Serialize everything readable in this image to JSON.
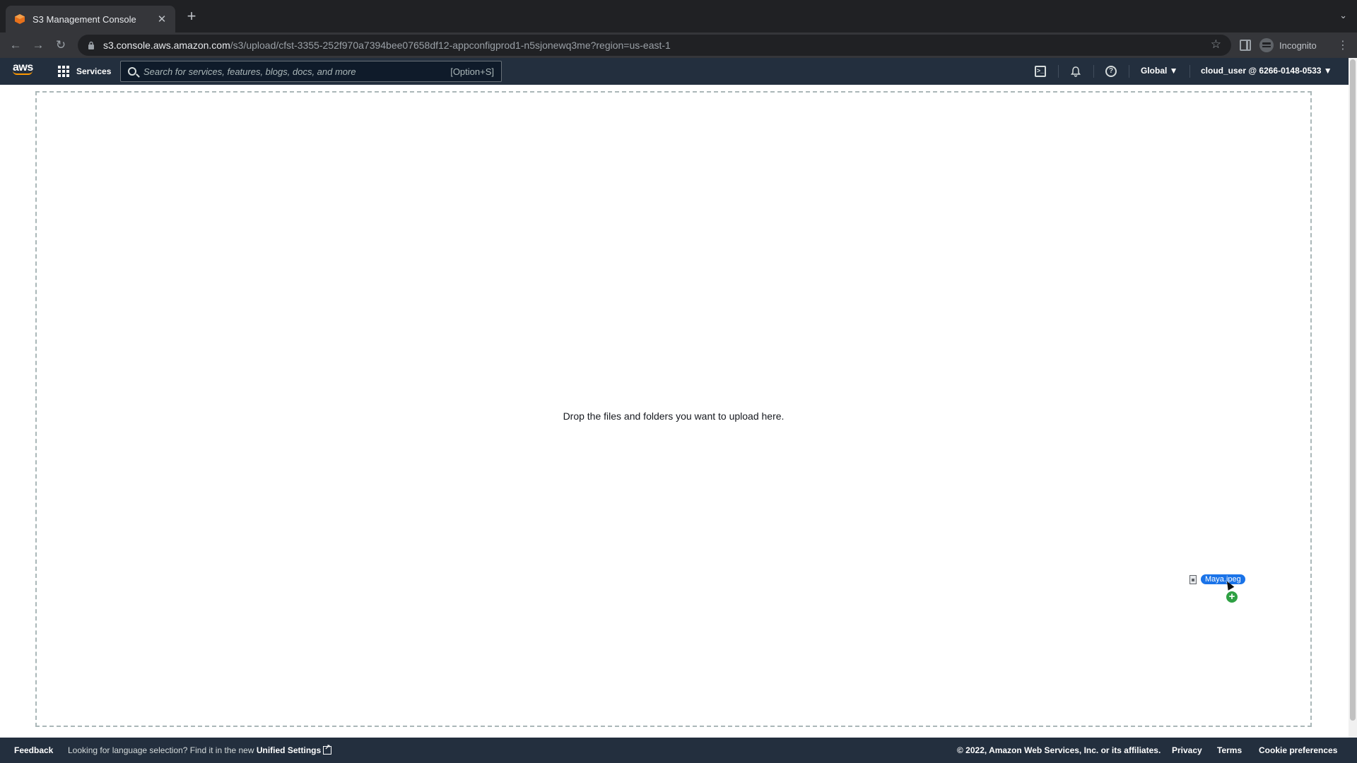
{
  "browser": {
    "tab_title": "S3 Management Console",
    "new_tab_symbol": "+",
    "close_symbol": "✕",
    "url_host": "s3.console.aws.amazon.com",
    "url_path": "/s3/upload/cfst-3355-252f970a7394bee07658df12-appconfigprod1-n5sjonewq3me?region=us-east-1",
    "profile_label": "Incognito"
  },
  "header": {
    "logo_text": "aws",
    "services_label": "Services",
    "search_placeholder": "Search for services, features, blogs, docs, and more",
    "search_shortcut": "[Option+S]",
    "region_label": "Global ▼",
    "account_label": "cloud_user @ 6266-0148-0533 ▼"
  },
  "main": {
    "drop_message": "Drop the files and folders you want to upload here.",
    "dragged_file": "Maya.jpeg",
    "copy_badge": "+"
  },
  "footer": {
    "feedback": "Feedback",
    "language_notice": "Looking for language selection? Find it in the new ",
    "unified_settings": "Unified Settings",
    "copyright": "© 2022, Amazon Web Services, Inc. or its affiliates.",
    "privacy": "Privacy",
    "terms": "Terms",
    "cookie_preferences": "Cookie preferences"
  },
  "colors": {
    "aws_nav_bg": "#232f3e",
    "aws_orange": "#ff9900",
    "chrome_dark": "#202124",
    "drag_label_blue": "#1a73e8",
    "copy_badge_green": "#2ea043"
  }
}
